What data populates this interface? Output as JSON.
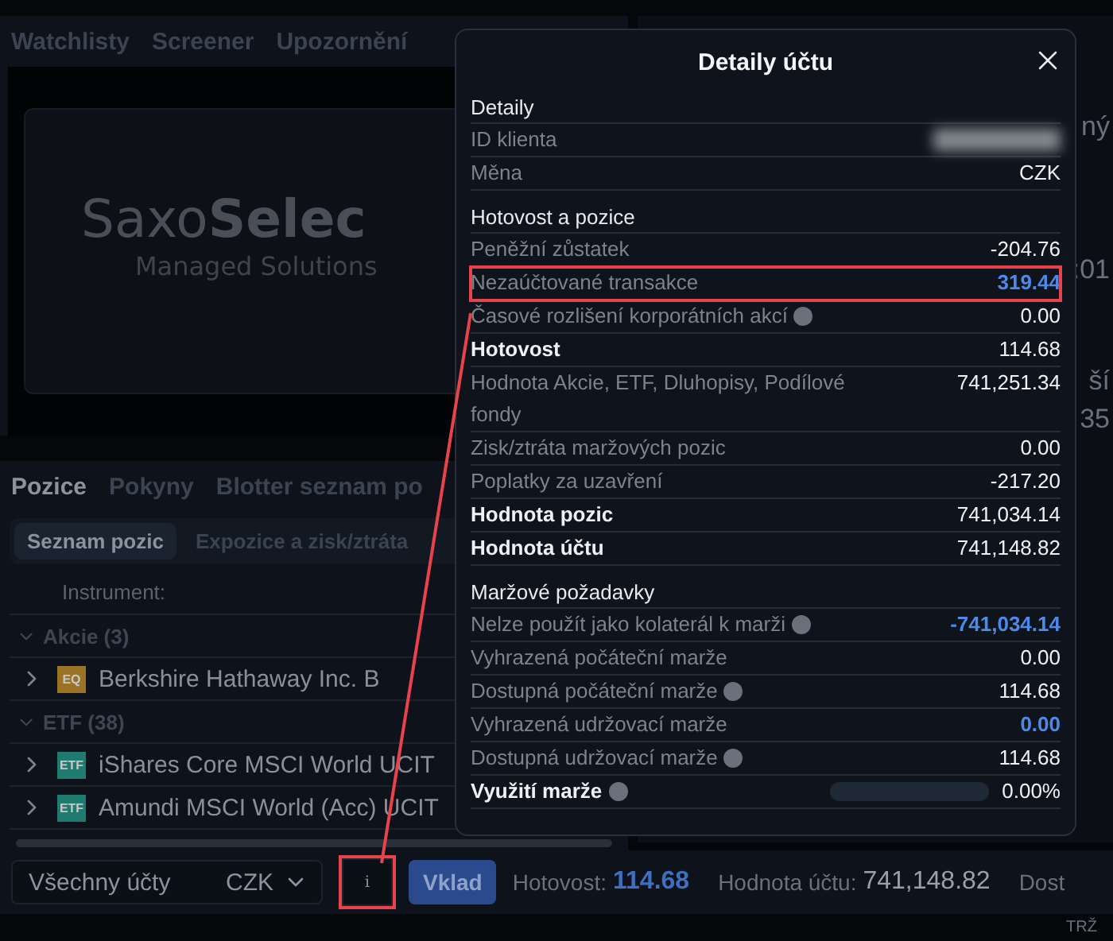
{
  "top_tabs": [
    {
      "label": "Watchlisty",
      "selected": false
    },
    {
      "label": "Screener",
      "selected": false
    },
    {
      "label": "Upozornění",
      "selected": false
    }
  ],
  "banner": {
    "brand_light": "Saxo",
    "brand_bold": "Selec",
    "tagline": "Managed Solutions"
  },
  "right_panel": {
    "fragments": [
      "ný",
      ":01",
      "ší",
      "35"
    ]
  },
  "positions": {
    "tabs": [
      {
        "label": "Pozice",
        "selected": true
      },
      {
        "label": "Pokyny",
        "selected": false
      },
      {
        "label": "Blotter seznam po",
        "selected": false
      }
    ],
    "subtabs": [
      {
        "label": "Seznam pozic",
        "selected": true
      },
      {
        "label": "Expozice a zisk/ztráta",
        "selected": false
      }
    ],
    "column_header": "Instrument:",
    "groups": [
      {
        "name": "Akcie (3)",
        "expanded": true,
        "rows": [
          {
            "badge": "EQ",
            "color": "#9a7424",
            "name": "Berkshire Hathaway Inc. B",
            "expanded": false
          }
        ]
      },
      {
        "name": "ETF (38)",
        "expanded": true,
        "rows": [
          {
            "badge": "ETF",
            "color": "#1f7a70",
            "name": "iShares Core MSCI World UCIT",
            "expanded": false
          },
          {
            "badge": "ETF",
            "color": "#1f7a70",
            "name": "Amundi MSCI World (Acc) UCIT",
            "expanded": false
          }
        ]
      }
    ]
  },
  "status_bar": {
    "account": "Všechny účty",
    "currency": "CZK",
    "info_button": {
      "label": "i",
      "highlighted": true
    },
    "deposit_button": "Vklad",
    "cash_label": "Hotovost:",
    "cash_value": "114.68",
    "account_value_label": "Hodnota účtu:",
    "account_value": "741,148.82",
    "cut_label": "Dost"
  },
  "footer": "TRŽ",
  "modal": {
    "title": "Detaily účtu",
    "sections": [
      {
        "title": "Detaily",
        "rows": [
          {
            "kind": "blurred",
            "label": "ID klienta"
          },
          {
            "kind": "value",
            "label": "Měna",
            "value": "CZK"
          }
        ]
      },
      {
        "title": "Hotovost a pozice",
        "rows": [
          {
            "kind": "value",
            "label": "Peněžní zůstatek",
            "value": "-204.76"
          },
          {
            "kind": "value",
            "label": "Nezaúčtované transakce",
            "value": "319.44",
            "accent": true,
            "highlighted": true
          },
          {
            "kind": "value",
            "label": "Časové rozlišení korporátních akcí",
            "value": "0.00",
            "help": true
          },
          {
            "kind": "value",
            "label": "Hotovost",
            "value": "114.68",
            "bold": true
          },
          {
            "kind": "value",
            "label": "Hodnota Akcie, ETF, Dluhopisy, Podílové fondy",
            "value": "741,251.34"
          },
          {
            "kind": "value",
            "label": "Zisk/ztráta maržových pozic",
            "value": "0.00"
          },
          {
            "kind": "value",
            "label": "Poplatky za uzavření",
            "value": "-217.20"
          },
          {
            "kind": "value",
            "label": "Hodnota pozic",
            "value": "741,034.14",
            "bold": true
          },
          {
            "kind": "value",
            "label": "Hodnota účtu",
            "value": "741,148.82",
            "bold": true
          }
        ]
      },
      {
        "title": "Maržové požadavky",
        "rows": [
          {
            "kind": "value",
            "label": "Nelze použít jako kolaterál k marži",
            "value": "-741,034.14",
            "accent": true,
            "help": true
          },
          {
            "kind": "value",
            "label": "Vyhrazená počáteční marže",
            "value": "0.00"
          },
          {
            "kind": "value",
            "label": "Dostupná počáteční marže",
            "value": "114.68",
            "help": true
          },
          {
            "kind": "value",
            "label": "Vyhrazená udržovací marže",
            "value": "0.00",
            "accent": true
          },
          {
            "kind": "value",
            "label": "Dostupná udržovací marže",
            "value": "114.68",
            "help": true
          },
          {
            "kind": "meter",
            "label": "Využití marže",
            "value": "0.00%",
            "bold": true,
            "help": true,
            "level": 0
          }
        ]
      }
    ]
  }
}
